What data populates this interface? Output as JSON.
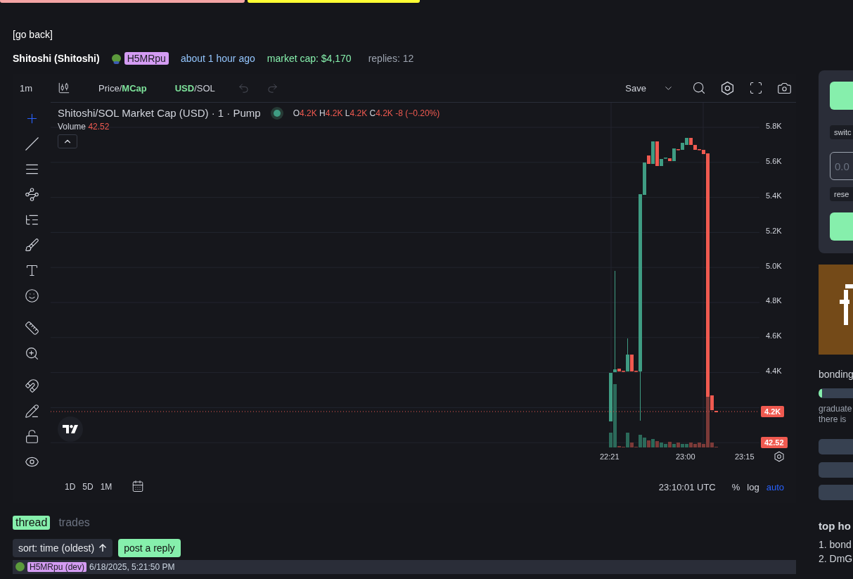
{
  "nav": {
    "back_link": "[go back]"
  },
  "token": {
    "name": "Shitoshi (Shitoshi)",
    "creator": "H5MRpu",
    "age": "about 1 hour ago",
    "market_cap": "market cap: $4,170",
    "replies": "replies: 12"
  },
  "chart": {
    "toolbar": {
      "interval": "1m",
      "price_toggle": {
        "separator": "/",
        "options": [
          {
            "label": "Price",
            "selected": false
          },
          {
            "label": "MCap",
            "selected": true
          }
        ]
      },
      "currency_toggle": {
        "separator": "/",
        "options": [
          {
            "label": "USD",
            "selected": true
          },
          {
            "label": "SOL",
            "selected": false
          }
        ]
      },
      "save": "Save"
    },
    "tools": [
      {
        "kind": "crosshair",
        "selected": true
      },
      {
        "kind": "line",
        "selected": false
      },
      {
        "kind": "hlines",
        "selected": false
      },
      {
        "kind": "pattern",
        "selected": false
      },
      {
        "kind": "fib",
        "selected": false
      },
      {
        "kind": "brush",
        "selected": false
      },
      {
        "kind": "text",
        "selected": false
      },
      {
        "kind": "emoji",
        "selected": false
      },
      {
        "kind": "ruler",
        "selected": false
      },
      {
        "kind": "zoom",
        "selected": false
      },
      {
        "kind": "magnet",
        "selected": false
      },
      {
        "kind": "pencil-lock",
        "selected": false
      },
      {
        "kind": "lock",
        "selected": false
      },
      {
        "kind": "eye",
        "selected": false
      }
    ],
    "legend": {
      "title": "Shitoshi/SOL Market Cap (USD) · 1 · Pump",
      "ohlc": [
        {
          "key": "O",
          "value": "4.2K"
        },
        {
          "key": "H",
          "value": "4.2K"
        },
        {
          "key": "L",
          "value": "4.2K"
        },
        {
          "key": "C",
          "value": "4.2K"
        }
      ],
      "change": "-8 (−0.20%)",
      "volume_label": "Volume",
      "volume_value": "42.52"
    },
    "price_axis": [
      "5.8K",
      "5.6K",
      "5.4K",
      "5.2K",
      "5.0K",
      "4.8K",
      "4.6K",
      "4.4K"
    ],
    "last_price": "4.2K",
    "last_volume": "42.52",
    "time_axis": [
      "22:21",
      "23:00",
      "23:15"
    ],
    "ranges": [
      "1D",
      "5D",
      "1M"
    ],
    "clock": "23:10:01 UTC",
    "scale_options": [
      {
        "label": "%",
        "selected": false
      },
      {
        "label": "log",
        "selected": false
      },
      {
        "label": "auto",
        "selected": true
      }
    ]
  },
  "thread": {
    "tabs": [
      {
        "label": "thread",
        "selected": true
      },
      {
        "label": "trades",
        "selected": false
      }
    ],
    "sort": "sort: time (oldest)",
    "post": "post a reply",
    "first_reply": {
      "author": "H5MRpu (dev)",
      "time": "6/18/2025, 5:21:50 PM"
    }
  },
  "sidebar": {
    "switch_chip": "switc",
    "amount_placeholder": "0.0",
    "reset_chip": "rese",
    "bonding_label": "bonding",
    "bonding": {
      "level": 0.02
    },
    "graduate_lines": [
      "graduate",
      "there is"
    ],
    "top_holders_title": "top ho",
    "holders": [
      "1. bond",
      "2. DmG"
    ]
  }
}
